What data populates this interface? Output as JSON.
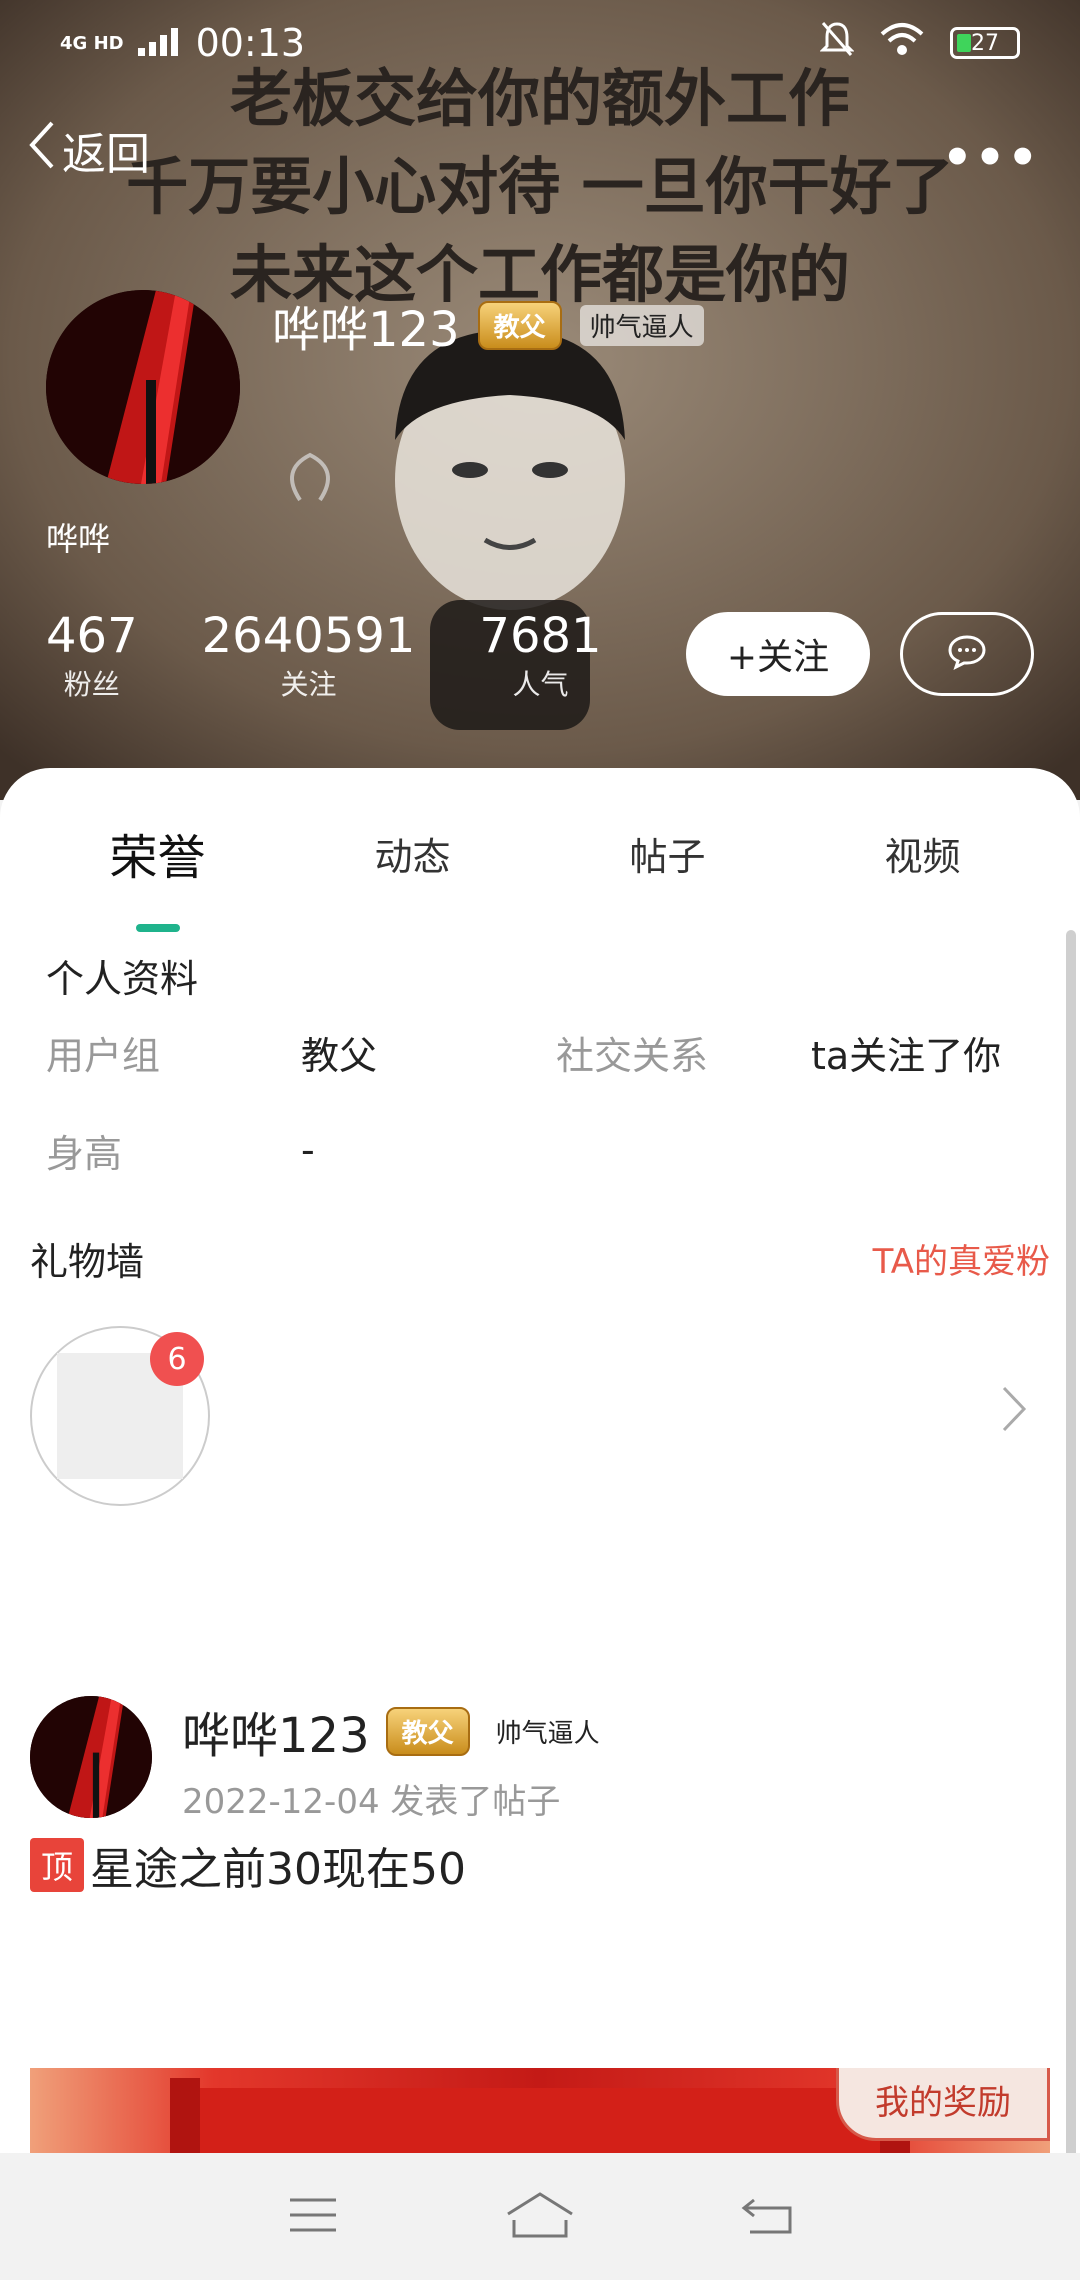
{
  "status_bar": {
    "network": "4G HD",
    "time": "00:13",
    "battery": "27"
  },
  "header": {
    "back_label": "返回",
    "more_label": "•••"
  },
  "cover_text": {
    "line1": "老板交给你的额外工作",
    "line2": "千万要小心对待 一旦你干好了",
    "line3": "未来这个工作都是你的"
  },
  "profile": {
    "username": "哗哗123",
    "badge_rank": "教父",
    "badge_title": "帅气逼人",
    "nickname": "哗哗",
    "stats": [
      {
        "value": "467",
        "label": "粉丝"
      },
      {
        "value": "2640591",
        "label": "关注"
      },
      {
        "value": "7681",
        "label": "人气"
      }
    ],
    "follow_label": "+关注"
  },
  "tabs": [
    {
      "label": "荣誉",
      "active": true
    },
    {
      "label": "动态",
      "active": false
    },
    {
      "label": "帖子",
      "active": false
    },
    {
      "label": "视频",
      "active": false
    }
  ],
  "personal_info": {
    "title": "个人资料",
    "group_label": "用户组",
    "group_value": "教父",
    "social_label": "社交关系",
    "social_value": "ta关注了你",
    "height_label": "身高",
    "height_value": "-"
  },
  "gift_wall": {
    "title": "礼物墙",
    "link": "TA的真爱粉",
    "count": "6"
  },
  "post": {
    "username": "哗哗123",
    "badge_rank": "教父",
    "badge_title": "帅气逼人",
    "date": "2022-12-04",
    "action": "发表了帖子",
    "top_tag": "顶",
    "title": "星途之前30现在50"
  },
  "banner": {
    "tag": "我的奖励"
  },
  "colors": {
    "accent": "#1fb38c",
    "link_red": "#e85a4a",
    "badge_red": "#f05050"
  }
}
